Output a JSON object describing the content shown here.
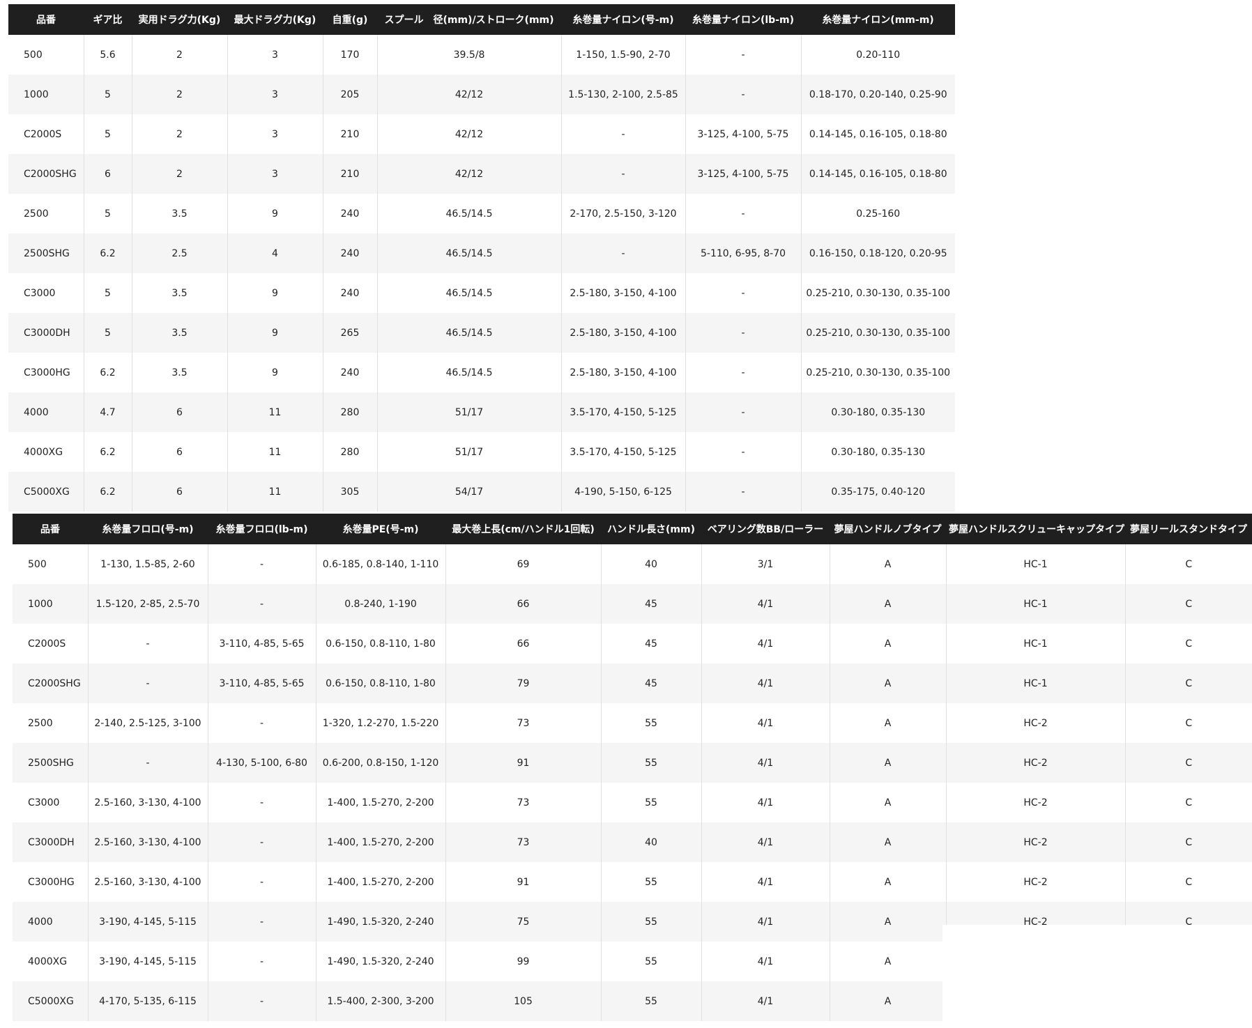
{
  "table1": {
    "headers": [
      "品番",
      "ギア比",
      "実用ドラグ力(Kg)",
      "最大ドラグ力(Kg)",
      "自重(g)",
      "スプール　径(mm)/ストローク(mm)",
      "糸巻量ナイロン(号-m)",
      "糸巻量ナイロン(lb-m)",
      "糸巻量ナイロン(mm-m)"
    ],
    "rows": [
      [
        "500",
        "5.6",
        "2",
        "3",
        "170",
        "39.5/8",
        "1-150, 1.5-90, 2-70",
        "-",
        "0.20-110"
      ],
      [
        "1000",
        "5",
        "2",
        "3",
        "205",
        "42/12",
        "1.5-130, 2-100, 2.5-85",
        "-",
        "0.18-170, 0.20-140, 0.25-90"
      ],
      [
        "C2000S",
        "5",
        "2",
        "3",
        "210",
        "42/12",
        "-",
        "3-125, 4-100, 5-75",
        "0.14-145, 0.16-105, 0.18-80"
      ],
      [
        "C2000SHG",
        "6",
        "2",
        "3",
        "210",
        "42/12",
        "-",
        "3-125, 4-100, 5-75",
        "0.14-145, 0.16-105, 0.18-80"
      ],
      [
        "2500",
        "5",
        "3.5",
        "9",
        "240",
        "46.5/14.5",
        "2-170, 2.5-150, 3-120",
        "-",
        "0.25-160"
      ],
      [
        "2500SHG",
        "6.2",
        "2.5",
        "4",
        "240",
        "46.5/14.5",
        "-",
        "5-110, 6-95, 8-70",
        "0.16-150, 0.18-120, 0.20-95"
      ],
      [
        "C3000",
        "5",
        "3.5",
        "9",
        "240",
        "46.5/14.5",
        "2.5-180, 3-150, 4-100",
        "-",
        "0.25-210, 0.30-130, 0.35-100"
      ],
      [
        "C3000DH",
        "5",
        "3.5",
        "9",
        "265",
        "46.5/14.5",
        "2.5-180, 3-150, 4-100",
        "-",
        "0.25-210, 0.30-130, 0.35-100"
      ],
      [
        "C3000HG",
        "6.2",
        "3.5",
        "9",
        "240",
        "46.5/14.5",
        "2.5-180, 3-150, 4-100",
        "-",
        "0.25-210, 0.30-130, 0.35-100"
      ],
      [
        "4000",
        "4.7",
        "6",
        "11",
        "280",
        "51/17",
        "3.5-170, 4-150, 5-125",
        "-",
        "0.30-180, 0.35-130"
      ],
      [
        "4000XG",
        "6.2",
        "6",
        "11",
        "280",
        "51/17",
        "3.5-170, 4-150, 5-125",
        "-",
        "0.30-180, 0.35-130"
      ],
      [
        "C5000XG",
        "6.2",
        "6",
        "11",
        "305",
        "54/17",
        "4-190, 5-150, 6-125",
        "-",
        "0.35-175, 0.40-120"
      ]
    ]
  },
  "table2": {
    "headers": [
      "品番",
      "糸巻量フロロ(号-m)",
      "糸巻量フロロ(lb-m)",
      "糸巻量PE(号-m)",
      "最大巻上長(cm/ハンドル1回転)",
      "ハンドル長さ(mm)",
      "ベアリング数BB/ローラー",
      "夢屋ハンドルノブタイプ",
      "夢屋ハンドルスクリューキャップタイプ",
      "夢屋リールスタンドタイプ"
    ],
    "rows": [
      [
        "500",
        "1-130, 1.5-85, 2-60",
        "-",
        "0.6-185, 0.8-140, 1-110",
        "69",
        "40",
        "3/1",
        "A",
        "HC-1",
        "C"
      ],
      [
        "1000",
        "1.5-120, 2-85, 2.5-70",
        "-",
        "0.8-240, 1-190",
        "66",
        "45",
        "4/1",
        "A",
        "HC-1",
        "C"
      ],
      [
        "C2000S",
        "-",
        "3-110, 4-85, 5-65",
        "0.6-150, 0.8-110, 1-80",
        "66",
        "45",
        "4/1",
        "A",
        "HC-1",
        "C"
      ],
      [
        "C2000SHG",
        "-",
        "3-110, 4-85, 5-65",
        "0.6-150, 0.8-110, 1-80",
        "79",
        "45",
        "4/1",
        "A",
        "HC-1",
        "C"
      ],
      [
        "2500",
        "2-140, 2.5-125, 3-100",
        "-",
        "1-320, 1.2-270, 1.5-220",
        "73",
        "55",
        "4/1",
        "A",
        "HC-2",
        "C"
      ],
      [
        "2500SHG",
        "-",
        "4-130, 5-100, 6-80",
        "0.6-200, 0.8-150, 1-120",
        "91",
        "55",
        "4/1",
        "A",
        "HC-2",
        "C"
      ],
      [
        "C3000",
        "2.5-160, 3-130, 4-100",
        "-",
        "1-400, 1.5-270, 2-200",
        "73",
        "55",
        "4/1",
        "A",
        "HC-2",
        "C"
      ],
      [
        "C3000DH",
        "2.5-160, 3-130, 4-100",
        "-",
        "1-400, 1.5-270, 2-200",
        "73",
        "40",
        "4/1",
        "A",
        "HC-2",
        "C"
      ],
      [
        "C3000HG",
        "2.5-160, 3-130, 4-100",
        "-",
        "1-400, 1.5-270, 2-200",
        "91",
        "55",
        "4/1",
        "A",
        "HC-2",
        "C"
      ],
      [
        "4000",
        "3-190, 4-145, 5-115",
        "-",
        "1-490, 1.5-320, 2-240",
        "75",
        "55",
        "4/1",
        "A",
        "HC-2",
        "C"
      ],
      [
        "4000XG",
        "3-190, 4-145, 5-115",
        "-",
        "1-490, 1.5-320, 2-240",
        "99",
        "55",
        "4/1",
        "A",
        "",
        ""
      ],
      [
        "C5000XG",
        "4-170, 5-135, 6-115",
        "-",
        "1.5-400, 2-300, 3-200",
        "105",
        "55",
        "4/1",
        "A",
        "",
        ""
      ]
    ]
  }
}
